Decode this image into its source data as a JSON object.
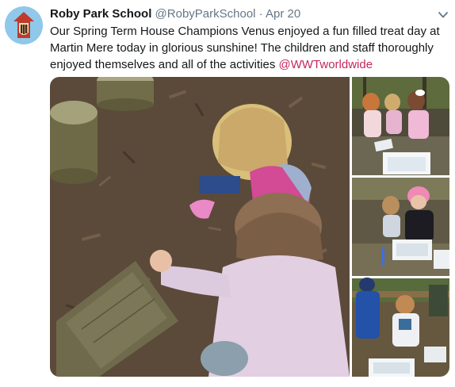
{
  "tweet": {
    "display_name": "Roby Park School",
    "handle": "@RobyParkSchool",
    "separator": "·",
    "date": "Apr 20",
    "text_before_mention": "Our Spring Term House Champions Venus enjoyed a fun filled treat day at Martin Mere today in glorious sunshine! The children and staff thoroughly enjoyed themselves and all of the activities ",
    "mention": "@WWTworldwide"
  },
  "icons": {
    "menu": "chevron-down-icon",
    "avatar": "school-crest-logo"
  },
  "colors": {
    "text": "#14171a",
    "secondary_text": "#657786",
    "mention": "#c4275b",
    "avatar_bg": "#8fc8ea"
  },
  "media": {
    "photo_count": 4
  }
}
